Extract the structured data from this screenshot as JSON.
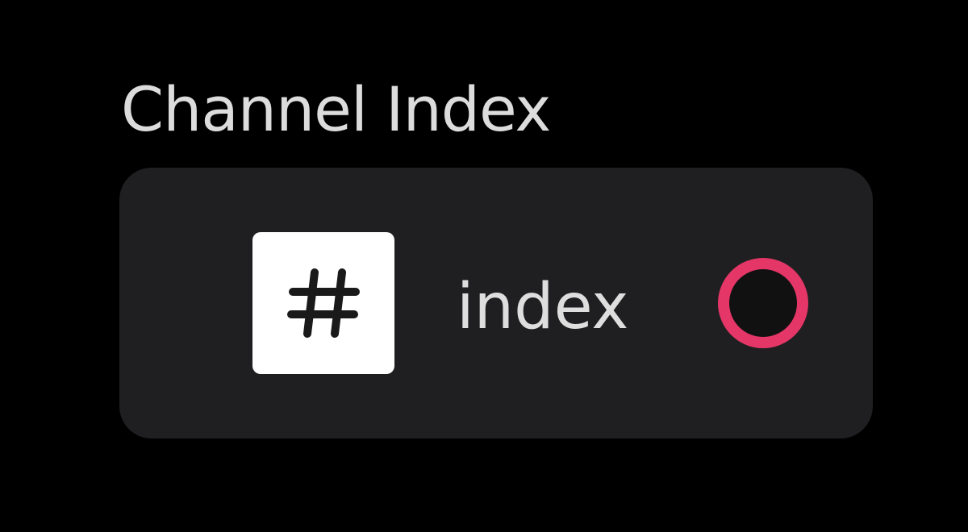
{
  "section": {
    "title": "Channel Index"
  },
  "channel": {
    "name": "index",
    "icon": "hash-icon",
    "selected": false
  },
  "colors": {
    "background": "#000000",
    "card": "#1f1f21",
    "text": "#dcdcdc",
    "accent": "#e43667",
    "icon_tile": "#ffffff"
  }
}
